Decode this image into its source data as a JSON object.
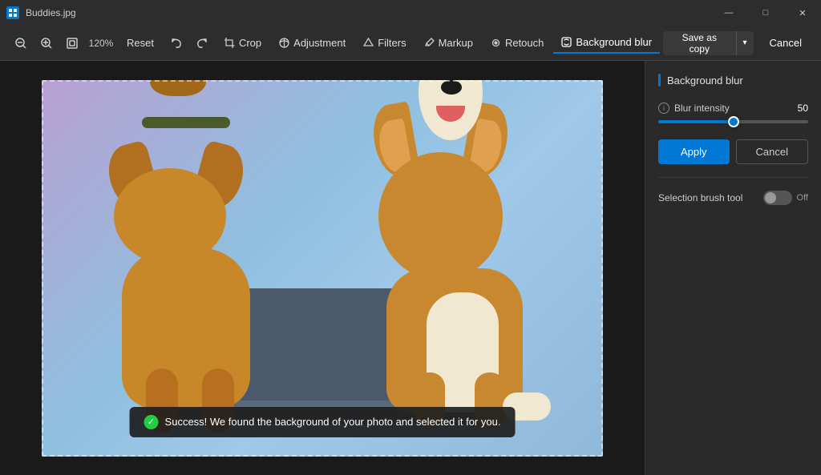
{
  "titleBar": {
    "title": "Buddies.jpg",
    "minBtn": "—",
    "maxBtn": "□",
    "closeBtn": "✕"
  },
  "toolbar": {
    "zoomOut": "−",
    "zoomIn": "+",
    "fitScreen": "⊡",
    "zoomLevel": "120%",
    "resetBtn": "Reset",
    "undoBtn": "↩",
    "redoBtn": "↪",
    "tools": [
      {
        "id": "crop",
        "icon": "⊡",
        "label": "Crop"
      },
      {
        "id": "adjustment",
        "icon": "⊕",
        "label": "Adjustment"
      },
      {
        "id": "filters",
        "icon": "◈",
        "label": "Filters"
      },
      {
        "id": "markup",
        "icon": "✏",
        "label": "Markup"
      },
      {
        "id": "retouch",
        "icon": "⊛",
        "label": "Retouch"
      },
      {
        "id": "background-blur",
        "icon": "⊡",
        "label": "Background blur"
      }
    ],
    "saveLabel": "Save as copy",
    "cancelLabel": "Cancel"
  },
  "panel": {
    "title": "Background blur",
    "blurIntensityLabel": "Blur intensity",
    "blurValue": "50",
    "sliderMin": 0,
    "sliderMax": 100,
    "sliderValue": 50,
    "sliderFillPercent": 50,
    "sliderThumbPercent": 50,
    "applyLabel": "Apply",
    "cancelLabel": "Cancel",
    "selectionBrushLabel": "Selection brush tool",
    "toggleState": "Off"
  },
  "toast": {
    "message": "Success! We found the background of your photo and selected it for you."
  },
  "icons": {
    "check": "✓",
    "info": "i",
    "dropdownArrow": "▾",
    "zoomIn": "🔍",
    "zoomOut": "🔍",
    "crop": "⊡",
    "adjustment": "◑",
    "filters": "◈",
    "markup": "✏",
    "retouch": "✦",
    "backgroundBlur": "⊡"
  }
}
